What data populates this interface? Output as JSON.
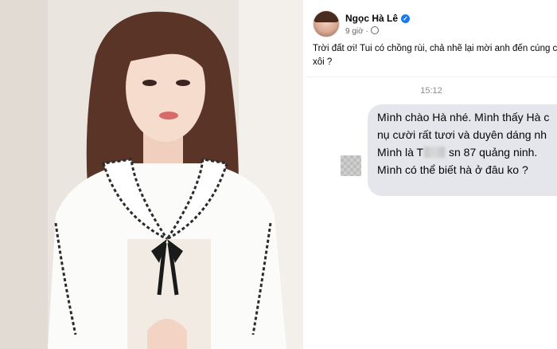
{
  "post": {
    "author": "Ngọc Hà Lê",
    "time": "9 giờ ·",
    "caption": "Trời đất ơi! Tui có chồng rùi, chả nhẽ lại mời anh đến cúng c xôi ?"
  },
  "chat": {
    "timestamp": "15:12",
    "lines": [
      "Mình chào Hà nhé. Mình thấy Hà c",
      "nụ cười rất tươi và duyên dáng nh",
      "sn 87 quảng ninh.",
      "Mình có thể biết hà ở đâu ko ?"
    ],
    "line3_prefix": "Mình là T"
  },
  "icons": {
    "verified": "verified-badge-icon",
    "privacy": "globe-icon"
  },
  "colors": {
    "bubble": "#e4e6eb",
    "verified": "#1877f2",
    "meta": "#65676b"
  }
}
